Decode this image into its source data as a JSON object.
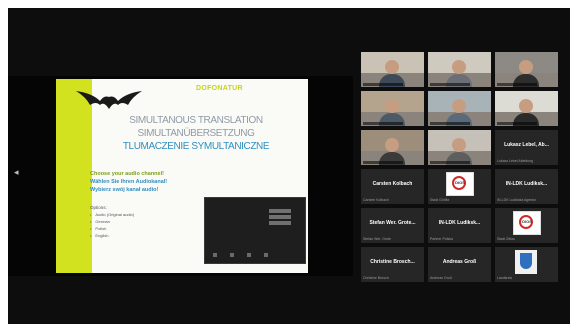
{
  "slide": {
    "brand": "DOFONATUR",
    "titles": [
      "SIMULTANOUS TRANSLATION",
      "SIMULTANÜBERSETZUNG",
      "TLUMACZENIE SYMULTANICZNE"
    ],
    "questions": [
      "Choose your audio channel!",
      "Wählen Sie Ihren Audiokanal!",
      "Wybierz swój kanał audio!"
    ],
    "options_title": "Options:",
    "options": [
      "Audio (Original audio)",
      "German",
      "Polish",
      "English"
    ]
  },
  "side_arrow": "◂",
  "participants": [
    {
      "type": "video",
      "wall": "#c9c2b5",
      "shirt": "#3e4a57"
    },
    {
      "type": "video",
      "wall": "#cfcac0",
      "shirt": "#6b6f75"
    },
    {
      "type": "video",
      "wall": "#8d8a86",
      "shirt": "#2d2d2d"
    },
    {
      "type": "video",
      "wall": "#b4a48e",
      "shirt": "#4d5966"
    },
    {
      "type": "video",
      "wall": "#a8b3b7",
      "shirt": "#5a6a7a"
    },
    {
      "type": "video",
      "wall": "#dcdcd4",
      "shirt": "#2b2b2b"
    },
    {
      "type": "video",
      "wall": "#9d8d7b",
      "shirt": "#3b3b3b"
    },
    {
      "type": "video",
      "wall": "#c6c1b8",
      "shirt": "#5e5e5e"
    },
    {
      "type": "name",
      "name": "Lukasz Lebel, Ab...",
      "sub": "Lukasz Lebel Abteilung"
    },
    {
      "type": "name",
      "name": "Carsten Kolbach",
      "sub": "Carsten Kolbach"
    },
    {
      "type": "logo",
      "logo_text": "DIOS",
      "sub": "Stadt Görlitz"
    },
    {
      "type": "name",
      "name": "IN-LDK Ludiksk...",
      "sub": "IN-LDK Ludikska Agentur"
    },
    {
      "type": "name",
      "name": "Stefan Wer. Grote...",
      "sub": "Stefan Wer. Grote"
    },
    {
      "type": "name",
      "name": "IN-LDK Ludiksk...",
      "sub": "Partner Polska"
    },
    {
      "type": "logo",
      "logo_text": "DIOS",
      "sub": "Stadt Zittau"
    },
    {
      "type": "name",
      "name": "Christine Brosch...",
      "sub": "Christine Brosch"
    },
    {
      "type": "name",
      "name": "Andreas Groß",
      "sub": "Andreas Groß"
    },
    {
      "type": "crest",
      "sub": "Landkreis"
    }
  ]
}
